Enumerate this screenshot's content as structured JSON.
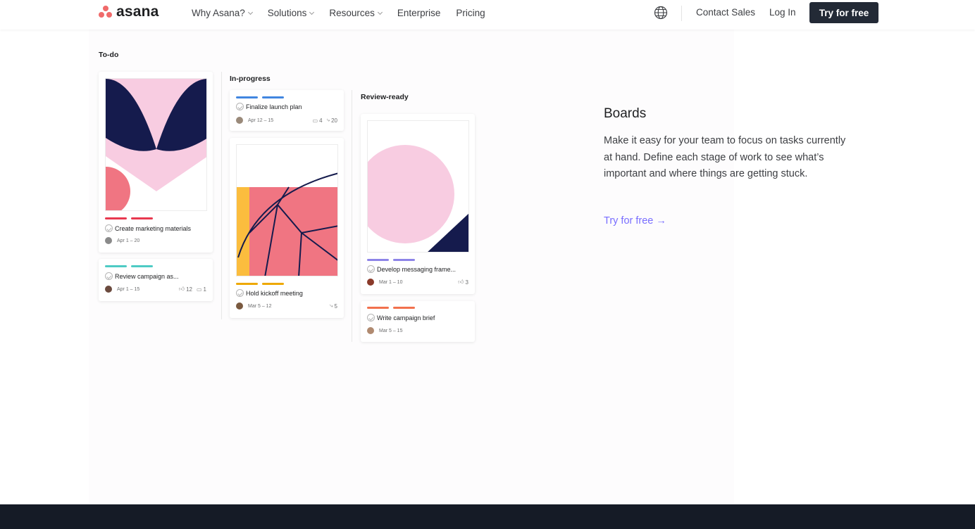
{
  "nav": {
    "logo_text": "asana",
    "links": [
      {
        "label": "Why Asana?",
        "dropdown": true
      },
      {
        "label": "Solutions",
        "dropdown": true
      },
      {
        "label": "Resources",
        "dropdown": true
      },
      {
        "label": "Enterprise",
        "dropdown": false
      },
      {
        "label": "Pricing",
        "dropdown": false
      }
    ],
    "globe_icon": "globe-icon",
    "contact_label": "Contact Sales",
    "login_label": "Log In",
    "try_label": "Try for free"
  },
  "board": {
    "columns": [
      {
        "title": "To-do",
        "cards": [
          {
            "task": "Create marketing materials",
            "dates": "Apr 1 – 20",
            "tag_color": "#e8384f"
          },
          {
            "task": "Review campaign as...",
            "dates": "Apr 1 – 15",
            "likes": "12",
            "comments": "1",
            "tag_color": "#4ecbc4"
          }
        ]
      },
      {
        "title": "In-progress",
        "cards": [
          {
            "task": "Finalize launch plan",
            "dates": "Apr 12 – 15",
            "comments": "4",
            "subtasks": "20",
            "tag_color": "#4186e0"
          },
          {
            "task": "Hold kickoff meeting",
            "dates": "Mar 5 – 12",
            "subtasks": "5",
            "tag_color": "#eea800"
          }
        ]
      },
      {
        "title": "Review-ready",
        "cards": [
          {
            "task": "Develop messaging frame...",
            "dates": "Mar 1 – 10",
            "likes": "3",
            "tag_color": "#8d84e8"
          },
          {
            "task": "Write campaign brief",
            "dates": "Mar 5 – 15",
            "tag_color": "#f2714d"
          }
        ]
      }
    ]
  },
  "feature": {
    "title": "Boards",
    "description": "Make it easy for your team to focus on tasks currently at hand. Define each stage of work to see what’s important and where things are getting stuck.",
    "cta": "Try for free →"
  },
  "colors": {
    "brand_coral": "#f06a6a",
    "nav_button_bg": "#232a36",
    "link_purple": "#796eff",
    "footer_bg": "#151b26",
    "art_navy": "#151b4d",
    "art_pink": "#f8cce1",
    "art_coral": "#f07582",
    "art_yellow": "#fbbd3e"
  }
}
